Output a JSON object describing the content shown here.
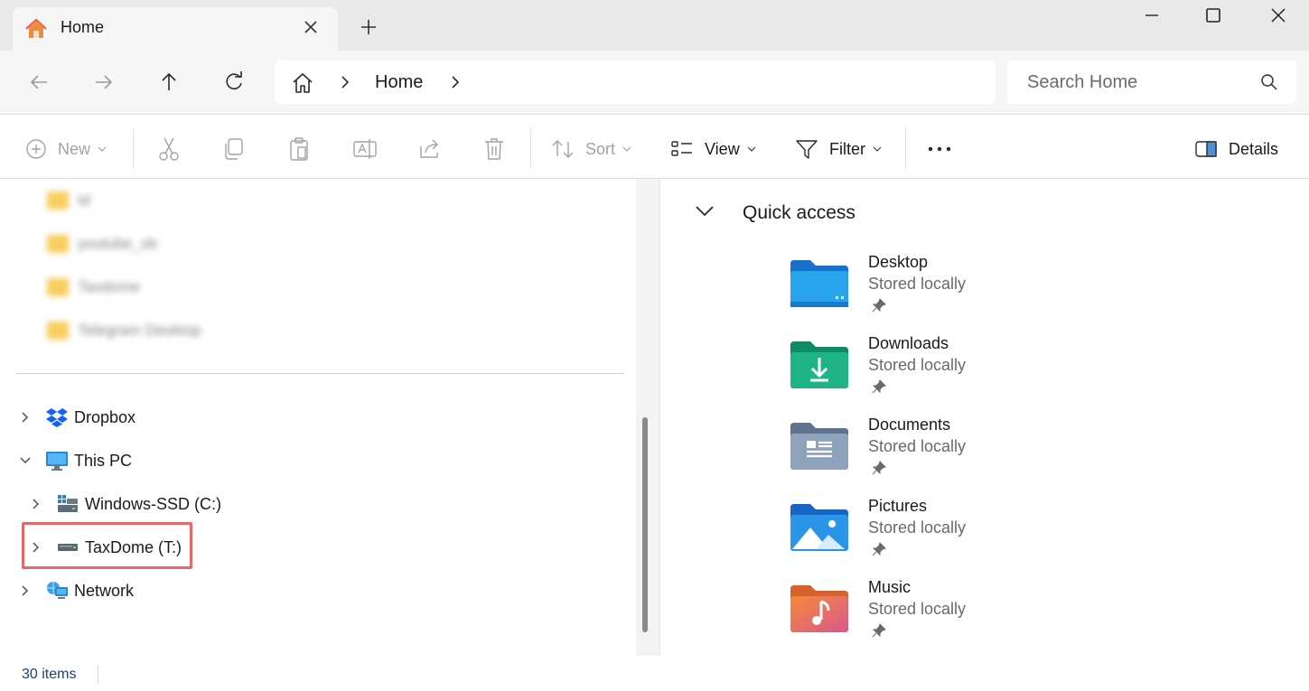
{
  "window": {
    "tab_title": "Home",
    "tab_icon": "home-icon",
    "new_tab_icon": "plus-icon",
    "controls": [
      "minimize-icon",
      "maximize-icon",
      "close-icon"
    ]
  },
  "nav": {
    "buttons": [
      "back-arrow-icon",
      "forward-arrow-icon",
      "up-arrow-icon",
      "refresh-icon"
    ],
    "breadcrumb": [
      "Home"
    ],
    "search_placeholder": "Search Home"
  },
  "toolbar": {
    "new_label": "New",
    "sort_label": "Sort",
    "view_label": "View",
    "filter_label": "Filter",
    "details_label": "Details",
    "disabled_icons": [
      "cut-icon",
      "copy-icon",
      "paste-icon",
      "rename-icon",
      "share-icon",
      "delete-icon"
    ]
  },
  "tree": {
    "blurred_items": [
      "td",
      "youtube_sb",
      "Taxdome",
      "Telegram Desktop"
    ],
    "items": [
      {
        "label": "Dropbox",
        "icon": "dropbox-icon",
        "expanded": false
      },
      {
        "label": "This PC",
        "icon": "monitor-icon",
        "expanded": true
      },
      {
        "label": "Windows-SSD (C:)",
        "icon": "system-drive-icon",
        "expanded": false
      },
      {
        "label": "TaxDome (T:)",
        "icon": "network-drive-icon",
        "expanded": false,
        "highlighted": true
      },
      {
        "label": "Network",
        "icon": "network-icon",
        "expanded": false
      }
    ]
  },
  "quick_access": {
    "title": "Quick access",
    "items": [
      {
        "name": "Desktop",
        "status": "Stored locally",
        "icon": "desktop-folder-icon",
        "color": "#1e9be0"
      },
      {
        "name": "Downloads",
        "status": "Stored locally",
        "icon": "downloads-folder-icon",
        "color": "#1aa37a"
      },
      {
        "name": "Documents",
        "status": "Stored locally",
        "icon": "documents-folder-icon",
        "color": "#7b8fa8"
      },
      {
        "name": "Pictures",
        "status": "Stored locally",
        "icon": "pictures-folder-icon",
        "color": "#1f8fe6"
      },
      {
        "name": "Music",
        "status": "Stored locally",
        "icon": "music-folder-icon",
        "color": "#ec7344"
      }
    ]
  },
  "status": {
    "item_count": "30 items"
  },
  "colors": {
    "highlight": "#e4676a",
    "chrome": "#e9e9ea",
    "status_text": "#1f3f78"
  }
}
